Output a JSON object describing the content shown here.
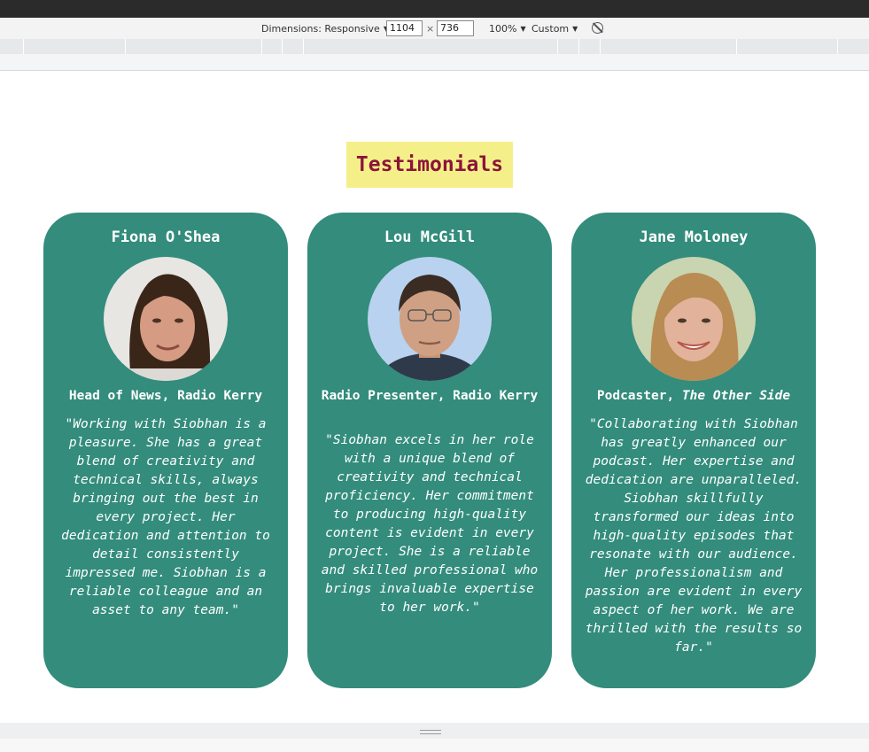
{
  "devtools": {
    "dimensions_label": "Dimensions: Responsive",
    "width_value": "1104",
    "times_symbol": "×",
    "height_value": "736",
    "zoom_label": "100%",
    "throttle_label": "Custom"
  },
  "page": {
    "heading": "Testimonials",
    "heading_bg": "#f5ef8a",
    "heading_color": "#8b1538",
    "card_color": "#338c7c"
  },
  "testimonials": [
    {
      "name": "Fiona O'Shea",
      "title": "Head of News, Radio Kerry",
      "quote": "\"Working with Siobhan is a pleasure. She has a great blend of creativity and technical skills, always bringing out the best in every project. Her dedication and attention to detail consistently impressed me. Siobhan is a reliable colleague and an asset to any team.\"",
      "photo": "woman-dark-hair-photo"
    },
    {
      "name": "Lou McGill",
      "title": "Radio Presenter, Radio Kerry",
      "quote": "\"Siobhan excels in her role with a unique blend of creativity and technical proficiency. Her commitment to producing high-quality content is evident in every project. She is a reliable and skilled professional who brings invaluable expertise to her work.\"",
      "photo": "man-glasses-photo"
    },
    {
      "name": "Jane Moloney",
      "title_prefix": "Podcaster, ",
      "title_emph": "The Other Side",
      "quote": "\"Collaborating with Siobhan has greatly enhanced our podcast. Her expertise and dedication are unparalleled. Siobhan skillfully transformed our ideas into high-quality episodes that resonate with our audience. Her professionalism and passion are evident in every aspect of her work. We are thrilled with the results so far.\"",
      "photo": "woman-blonde-hair-photo"
    }
  ]
}
